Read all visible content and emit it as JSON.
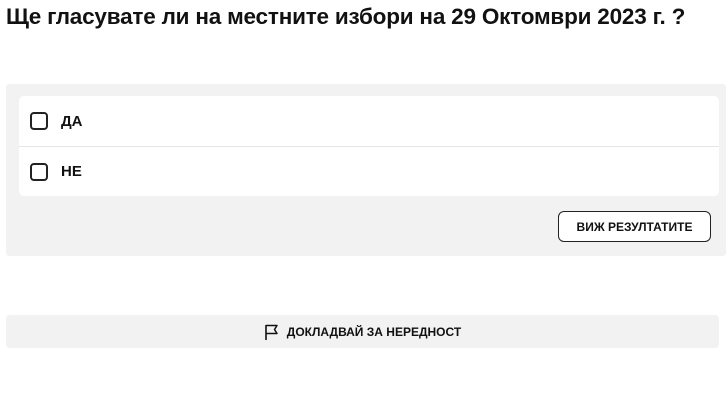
{
  "poll": {
    "question": "Ще гласувате ли на местните избори на 29 Октомври 2023 г. ?",
    "options": [
      {
        "label": "ДА",
        "checked": false
      },
      {
        "label": "НЕ",
        "checked": false
      }
    ],
    "results_button_label": "ВИЖ РЕЗУЛТАТИТЕ"
  },
  "report": {
    "icon": "flag-icon",
    "label": "ДОКЛАДВАЙ ЗА НЕРЕДНОСТ"
  },
  "colors": {
    "panel_background": "#f2f2f2",
    "option_background": "#ffffff",
    "text": "#111111"
  }
}
